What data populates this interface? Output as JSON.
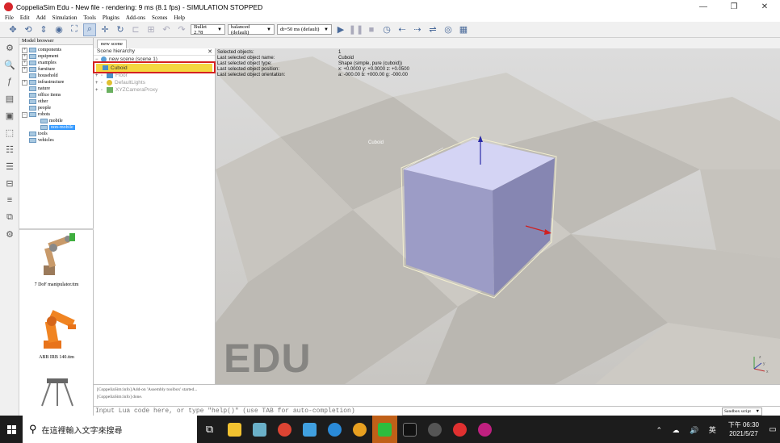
{
  "window": {
    "title": "CoppeliaSim Edu - New file - rendering: 9 ms (8.1 fps) - SIMULATION STOPPED",
    "minimize": "—",
    "maximize": "❐",
    "close": "✕"
  },
  "menu": [
    "File",
    "Edit",
    "Add",
    "Simulation",
    "Tools",
    "Plugins",
    "Add-ons",
    "Scenes",
    "Help"
  ],
  "toolbar": {
    "engine": "Bullet 2.78",
    "accuracy": "balanced (default)",
    "timestep": "dt=50 ms (default)"
  },
  "model_browser": {
    "header": "Model browser",
    "items": [
      {
        "label": "components",
        "exp": "+"
      },
      {
        "label": "equipment",
        "exp": "+"
      },
      {
        "label": "examples",
        "exp": "+"
      },
      {
        "label": "furniture",
        "exp": "+"
      },
      {
        "label": "household",
        "exp": ""
      },
      {
        "label": "infrastructure",
        "exp": "+"
      },
      {
        "label": "nature",
        "exp": ""
      },
      {
        "label": "office items",
        "exp": ""
      },
      {
        "label": "other",
        "exp": ""
      },
      {
        "label": "people",
        "exp": ""
      },
      {
        "label": "robots",
        "exp": "−"
      },
      {
        "label": "mobile",
        "exp": "",
        "indent": true
      },
      {
        "label": "non-mobile",
        "exp": "",
        "indent": true,
        "selected": true
      },
      {
        "label": "tools",
        "exp": ""
      },
      {
        "label": "vehicles",
        "exp": ""
      }
    ],
    "thumbnails": [
      "7 DoF manipulator.ttm",
      "ABB IRB 140.ttm"
    ]
  },
  "scene_tab": "new scene",
  "hierarchy": {
    "header": "Scene hierarchy",
    "close": "✕",
    "root": "new scene (scene 1)",
    "selected": "Cuboid",
    "items": [
      "Floor",
      "DefaultLights",
      "XYZCameraProxy"
    ]
  },
  "info": {
    "rows": [
      {
        "k": "Selected objects:",
        "v": "1"
      },
      {
        "k": "Last selected object name:",
        "v": "Cuboid"
      },
      {
        "k": "Last selected object type:",
        "v": "Shape (simple, pure (cuboid))"
      },
      {
        "k": "Last selected object position:",
        "v": "x: +0.0000   y: +0.0000   z: +0.0500"
      },
      {
        "k": "Last selected object orientation:",
        "v": "a: -000.00   b: +000.00   g: -000.00"
      }
    ]
  },
  "viewport": {
    "object_label": "Cuboid",
    "watermark": "EDU"
  },
  "console": {
    "lines": [
      "[CoppeliaSim:info] Add-on 'Assembly toolbox' started...",
      "[CoppeliaSim:info] done."
    ]
  },
  "lua": {
    "placeholder": "Input Lua code here, or type \"help()\" (use TAB for auto-completion)",
    "sandbox": "Sandbox script"
  },
  "taskbar": {
    "search_placeholder": "在這裡輸入文字來搜尋",
    "time": "下午 06:30",
    "date": "2021/5/27",
    "tray_icons": "⌃ ☁ 🔊 英"
  },
  "colors": {
    "highlight_red": "#d42020",
    "selection_yellow": "#f4d840",
    "cube_top": "#d4d4f4",
    "cube_front": "#9c9cc6",
    "cube_side": "#8686b2"
  }
}
